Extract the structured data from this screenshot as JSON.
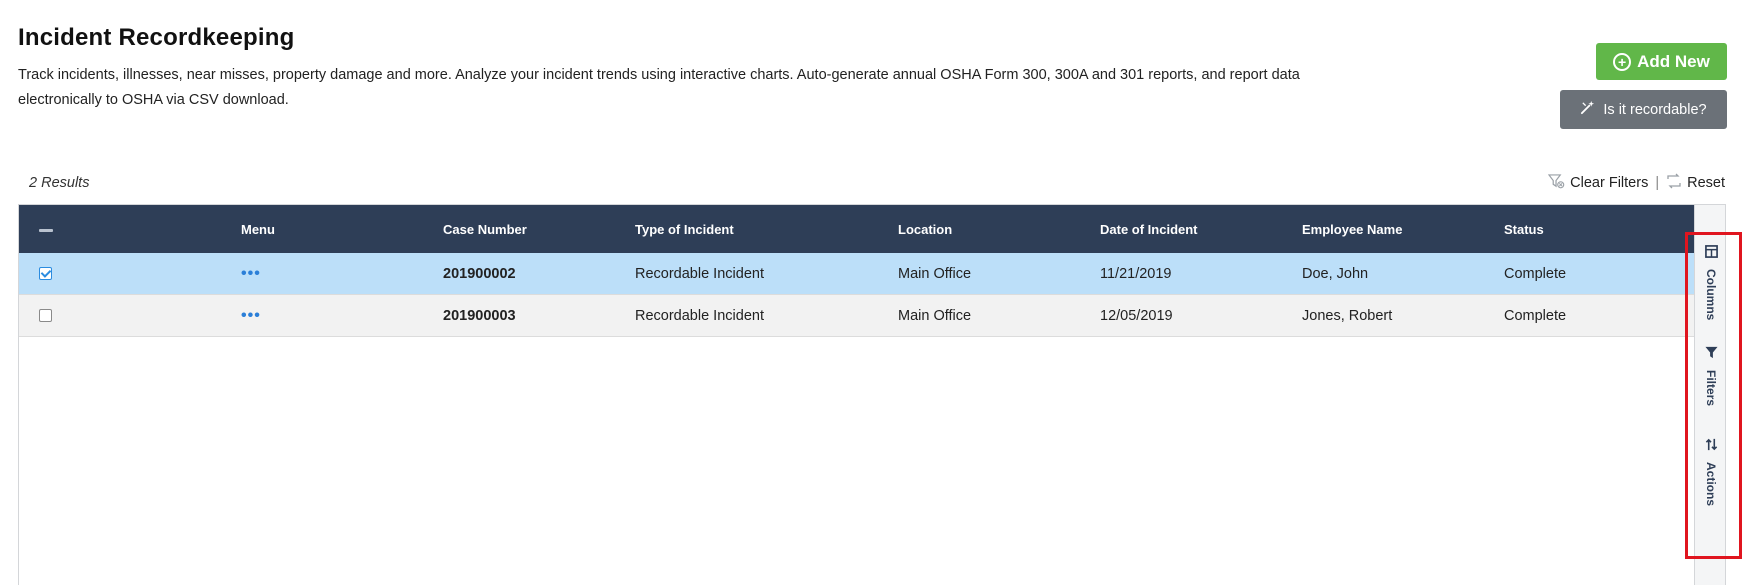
{
  "page": {
    "title": "Incident Recordkeeping",
    "description": "Track incidents, illnesses, near misses, property damage and more. Analyze your incident trends using interactive charts. Auto-generate annual OSHA Form 300, 300A and 301 reports, and report data electronically to OSHA via CSV download."
  },
  "buttons": {
    "add_new": "Add New",
    "is_recordable": "Is it recordable?"
  },
  "results": {
    "count_text": "2 Results",
    "clear_filters": "Clear Filters",
    "separator": "|",
    "reset": "Reset"
  },
  "table": {
    "columns": [
      "Menu",
      "Case Number",
      "Type of Incident",
      "Location",
      "Date of Incident",
      "Employee Name",
      "Status"
    ],
    "rows": [
      {
        "selected": true,
        "menu": "•••",
        "case_number": "201900002",
        "type": "Recordable Incident",
        "location": "Main Office",
        "date": "11/21/2019",
        "employee": "Doe, John",
        "status": "Complete"
      },
      {
        "selected": false,
        "menu": "•••",
        "case_number": "201900003",
        "type": "Recordable Incident",
        "location": "Main Office",
        "date": "12/05/2019",
        "employee": "Jones, Robert",
        "status": "Complete"
      }
    ]
  },
  "side_panel": {
    "columns": "Columns",
    "filters": "Filters",
    "actions": "Actions"
  },
  "colors": {
    "header_bg": "#2e3e57",
    "selected_row": "#bcdff9",
    "add_button": "#61b749",
    "recordable_button": "#6b7178",
    "highlight": "#e0151f",
    "link_blue": "#2b7fd8"
  }
}
